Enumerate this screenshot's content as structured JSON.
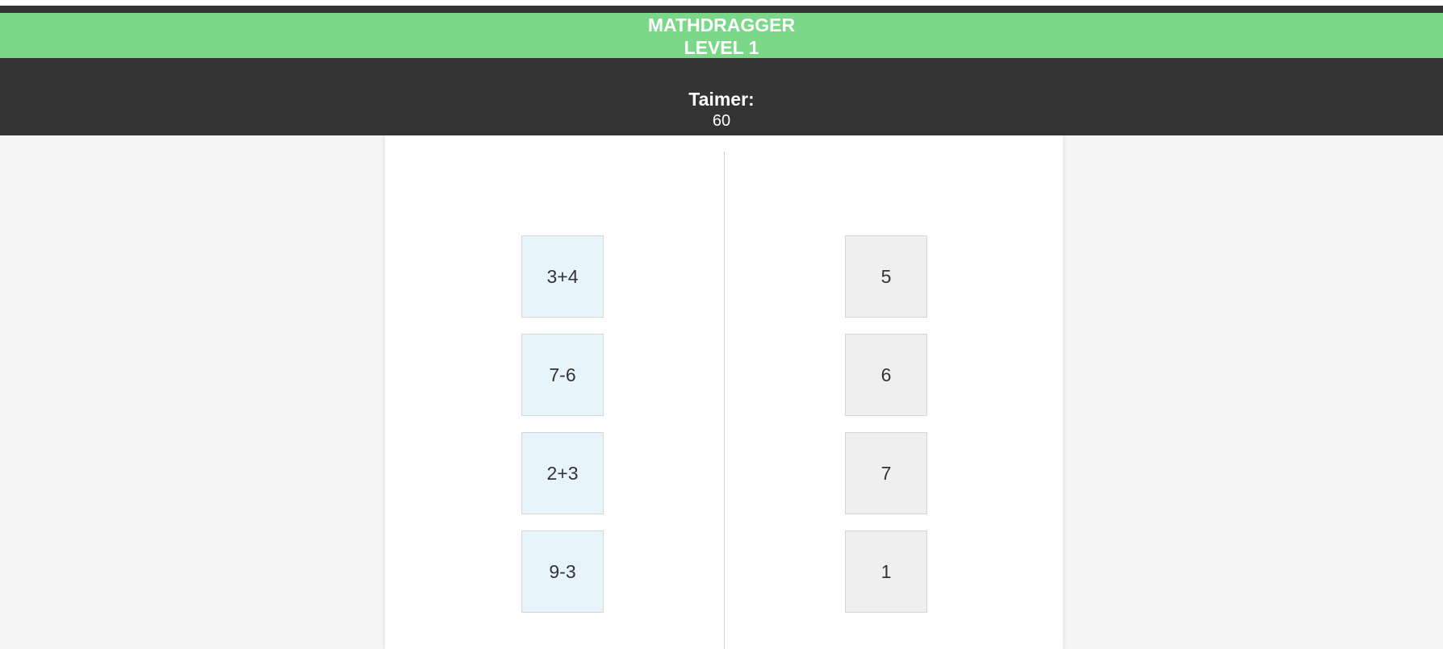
{
  "header": {
    "app_title": "MATHDRAGGER",
    "level": "LEVEL 1"
  },
  "timer": {
    "label": "Taimer:",
    "value": "60"
  },
  "expressions": [
    "3+4",
    "7-6",
    "2+3",
    "9-3"
  ],
  "answers": [
    "5",
    "6",
    "7",
    "1"
  ],
  "colors": {
    "title_bar": "#7bd888",
    "dark_bar": "#343434",
    "expression_tile": "#e8f4fc",
    "answer_tile": "#efefef"
  }
}
